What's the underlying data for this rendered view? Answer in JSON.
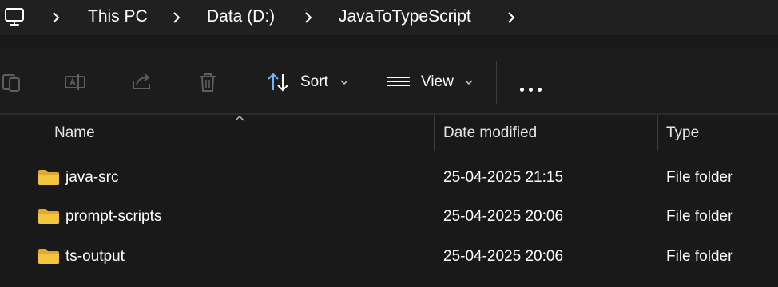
{
  "address_bar": {
    "crumbs": [
      "This PC",
      "Data (D:)",
      "JavaToTypeScript"
    ]
  },
  "toolbar": {
    "sort_label": "Sort",
    "view_label": "View"
  },
  "columns": {
    "name": "Name",
    "date": "Date modified",
    "type": "Type"
  },
  "files": [
    {
      "name": "java-src",
      "date": "25-04-2025 21:15",
      "type": "File folder"
    },
    {
      "name": "prompt-scripts",
      "date": "25-04-2025 20:06",
      "type": "File folder"
    },
    {
      "name": "ts-output",
      "date": "25-04-2025 20:06",
      "type": "File folder"
    }
  ],
  "colors": {
    "background": "#191919",
    "folder": "#f3c53d",
    "accent": "#6fb8f5"
  }
}
